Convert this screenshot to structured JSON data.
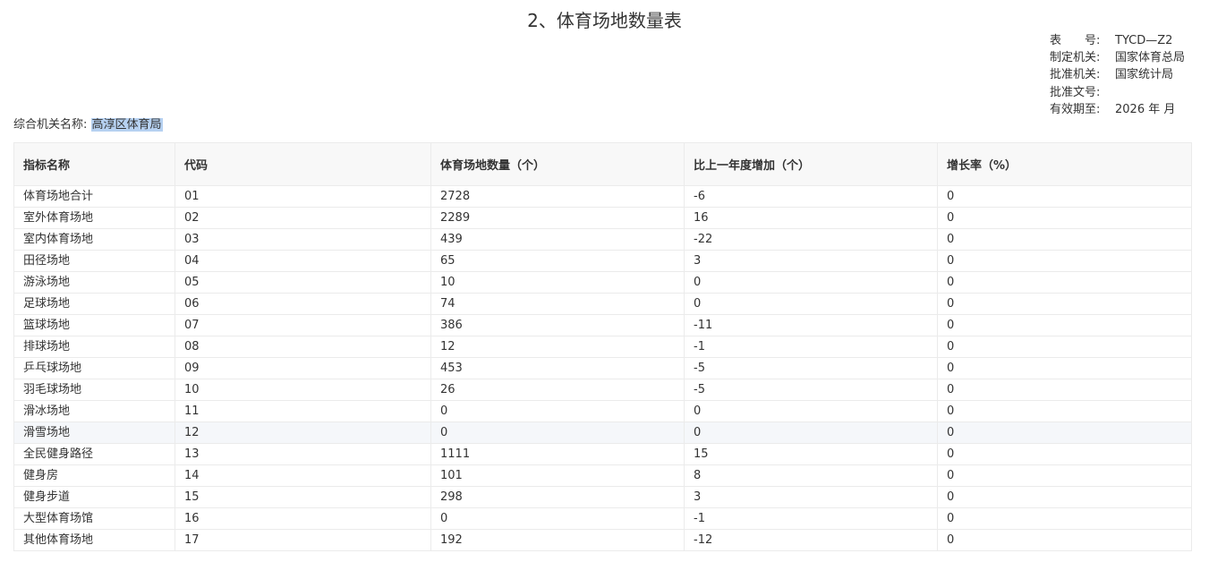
{
  "title": "2、体育场地数量表",
  "meta": [
    {
      "label": "表　　号:",
      "value": "TYCD—Z2"
    },
    {
      "label": "制定机关:",
      "value": "国家体育总局"
    },
    {
      "label": "批准机关:",
      "value": "国家统计局"
    },
    {
      "label": "批准文号:",
      "value": ""
    },
    {
      "label": "有效期至:",
      "value": "2026 年 月"
    }
  ],
  "org": {
    "label": "综合机关名称:",
    "value": "高淳区体育局"
  },
  "columns": [
    "指标名称",
    "代码",
    "体育场地数量（个）",
    "比上一年度增加（个）",
    "增长率（%）"
  ],
  "rows": [
    [
      "体育场地合计",
      "01",
      "2728",
      "-6",
      "0"
    ],
    [
      "室外体育场地",
      "02",
      "2289",
      "16",
      "0"
    ],
    [
      "室内体育场地",
      "03",
      "439",
      "-22",
      "0"
    ],
    [
      "田径场地",
      "04",
      "65",
      "3",
      "0"
    ],
    [
      "游泳场地",
      "05",
      "10",
      "0",
      "0"
    ],
    [
      "足球场地",
      "06",
      "74",
      "0",
      "0"
    ],
    [
      "篮球场地",
      "07",
      "386",
      "-11",
      "0"
    ],
    [
      "排球场地",
      "08",
      "12",
      "-1",
      "0"
    ],
    [
      "乒乓球场地",
      "09",
      "453",
      "-5",
      "0"
    ],
    [
      "羽毛球场地",
      "10",
      "26",
      "-5",
      "0"
    ],
    [
      "滑冰场地",
      "11",
      "0",
      "0",
      "0"
    ],
    [
      "滑雪场地",
      "12",
      "0",
      "0",
      "0"
    ],
    [
      "全民健身路径",
      "13",
      "1111",
      "15",
      "0"
    ],
    [
      "健身房",
      "14",
      "101",
      "8",
      "0"
    ],
    [
      "健身步道",
      "15",
      "298",
      "3",
      "0"
    ],
    [
      "大型体育场馆",
      "16",
      "0",
      "-1",
      "0"
    ],
    [
      "其他体育场地",
      "17",
      "192",
      "-12",
      "0"
    ]
  ],
  "highlight_row": 11
}
